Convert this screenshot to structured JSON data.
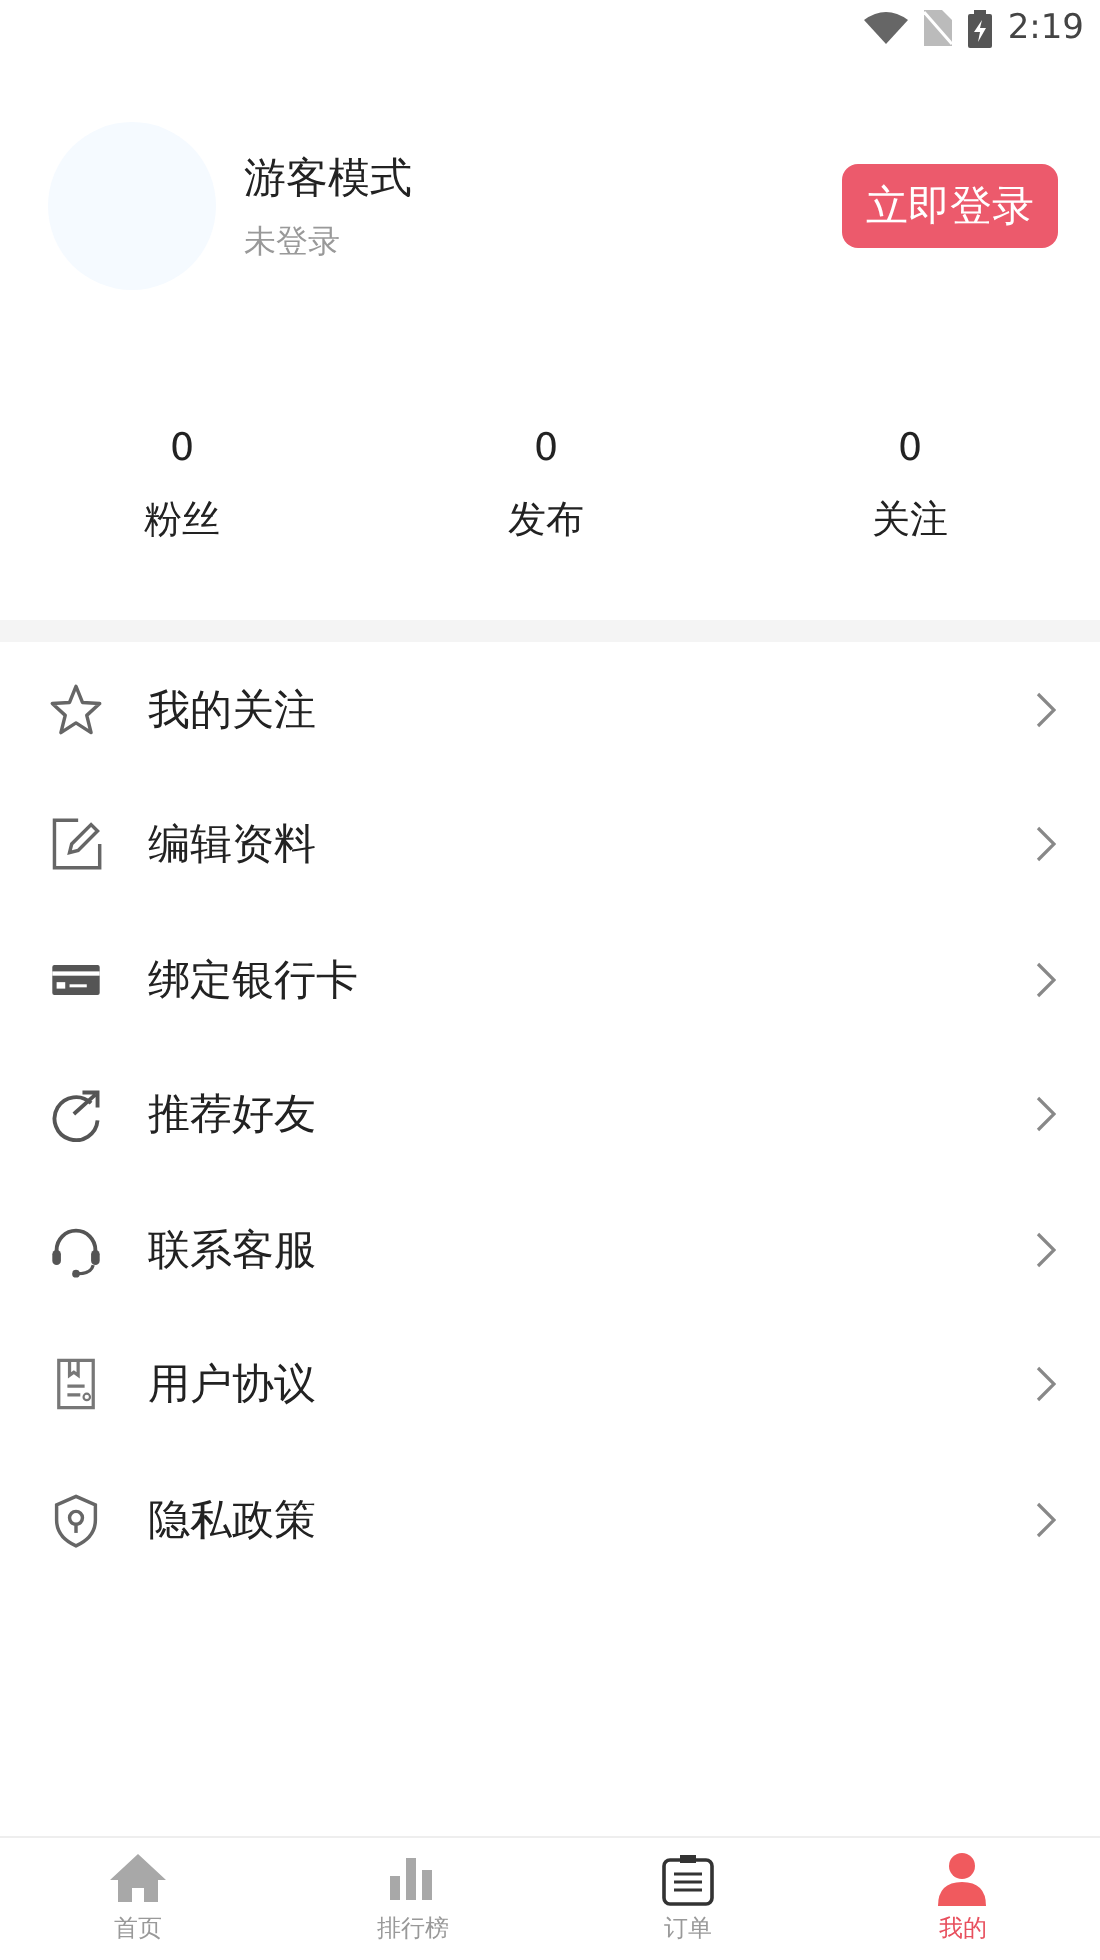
{
  "status_bar": {
    "time": "2:19"
  },
  "profile": {
    "name": "游客模式",
    "subtitle": "未登录",
    "login_button": "立即登录"
  },
  "stats": [
    {
      "value": "0",
      "label": "粉丝"
    },
    {
      "value": "0",
      "label": "发布"
    },
    {
      "value": "0",
      "label": "关注"
    }
  ],
  "menu": [
    {
      "kind": "star",
      "label": "我的关注"
    },
    {
      "kind": "edit",
      "label": "编辑资料"
    },
    {
      "kind": "card",
      "label": "绑定银行卡"
    },
    {
      "kind": "share",
      "label": "推荐好友"
    },
    {
      "kind": "headset",
      "label": "联系客服"
    },
    {
      "kind": "document",
      "label": "用户协议"
    },
    {
      "kind": "shield",
      "label": "隐私政策"
    }
  ],
  "tabs": [
    {
      "kind": "home",
      "label": "首页",
      "selected": false
    },
    {
      "kind": "chart",
      "label": "排行榜",
      "selected": false
    },
    {
      "kind": "clipboard",
      "label": "订单",
      "selected": false
    },
    {
      "kind": "person",
      "label": "我的",
      "selected": true
    }
  ]
}
